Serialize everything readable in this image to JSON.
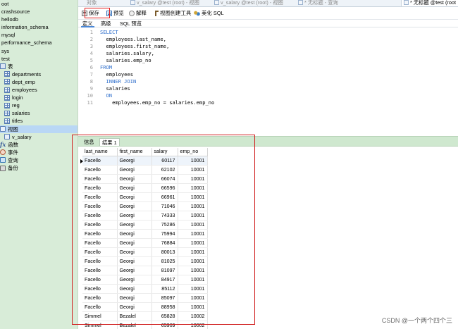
{
  "sidebar": {
    "items": [
      {
        "label": "oot",
        "icon": "database-icon",
        "kind": "db"
      },
      {
        "label": "crashsource",
        "icon": "database-icon",
        "kind": "db"
      },
      {
        "label": "hellodb",
        "icon": "database-icon",
        "kind": "db"
      },
      {
        "label": "information_schema",
        "icon": "database-icon",
        "kind": "db"
      },
      {
        "label": "mysql",
        "icon": "database-icon",
        "kind": "db"
      },
      {
        "label": "performance_schema",
        "icon": "database-icon",
        "kind": "db"
      },
      {
        "label": "sys",
        "icon": "database-icon",
        "kind": "db"
      },
      {
        "label": "test",
        "icon": "database-icon",
        "kind": "db"
      },
      {
        "label": "表",
        "icon": "tables-folder-icon",
        "kind": "folder"
      },
      {
        "label": "departments",
        "icon": "table-icon",
        "kind": "table"
      },
      {
        "label": "dept_emp",
        "icon": "table-icon",
        "kind": "table"
      },
      {
        "label": "employees",
        "icon": "table-icon",
        "kind": "table"
      },
      {
        "label": "login",
        "icon": "table-icon",
        "kind": "table"
      },
      {
        "label": "reg",
        "icon": "table-icon",
        "kind": "table"
      },
      {
        "label": "salaries",
        "icon": "table-icon",
        "kind": "table"
      },
      {
        "label": "titles",
        "icon": "table-icon",
        "kind": "table"
      },
      {
        "label": "视图",
        "icon": "views-folder-icon",
        "kind": "folder-selected"
      },
      {
        "label": "v_salary",
        "icon": "view-icon",
        "kind": "view"
      },
      {
        "label": "函数",
        "icon": "function-icon",
        "kind": "func"
      },
      {
        "label": "事件",
        "icon": "event-icon",
        "kind": "event"
      },
      {
        "label": "查询",
        "icon": "query-icon",
        "kind": "query"
      },
      {
        "label": "备份",
        "icon": "backup-icon",
        "kind": "backup"
      }
    ]
  },
  "tabs": [
    {
      "label": "对象"
    },
    {
      "label": "v_salary @test (root) - 视图"
    },
    {
      "label": "v_salary @test (root) - 视图"
    },
    {
      "label": "* 无标题 - 查询"
    },
    {
      "label": "* 无标题 @test (root"
    }
  ],
  "toolbar": {
    "save": "保存",
    "preview": "预览",
    "explain": "解释",
    "builder": "视图创建工具",
    "beautify": "美化 SQL"
  },
  "subtabs": [
    "定义",
    "高级",
    "SQL 预览"
  ],
  "editor": {
    "lines": [
      {
        "n": "1",
        "text": "SELECT",
        "kw": true
      },
      {
        "n": "2",
        "text": "  employees.last_name,"
      },
      {
        "n": "3",
        "text": "  employees.first_name,"
      },
      {
        "n": "4",
        "text": "  salaries.salary,"
      },
      {
        "n": "5",
        "text": "  salaries.emp_no"
      },
      {
        "n": "6",
        "text": "FROM",
        "kw": true
      },
      {
        "n": "7",
        "text": "  employees"
      },
      {
        "n": "8",
        "text": "  INNER JOIN",
        "kw": true
      },
      {
        "n": "9",
        "text": "  salaries"
      },
      {
        "n": "10",
        "text": "  ON",
        "kw": true
      },
      {
        "n": "11",
        "text": "    employees.emp_no = salaries.emp_no"
      }
    ]
  },
  "results": {
    "tabs": [
      "信息",
      "结果 1"
    ],
    "columns": [
      "last_name",
      "first_name",
      "salary",
      "emp_no"
    ],
    "rows": [
      [
        "Facello",
        "Georgi",
        "60117",
        "10001"
      ],
      [
        "Facello",
        "Georgi",
        "62102",
        "10001"
      ],
      [
        "Facello",
        "Georgi",
        "66074",
        "10001"
      ],
      [
        "Facello",
        "Georgi",
        "66596",
        "10001"
      ],
      [
        "Facello",
        "Georgi",
        "66961",
        "10001"
      ],
      [
        "Facello",
        "Georgi",
        "71046",
        "10001"
      ],
      [
        "Facello",
        "Georgi",
        "74333",
        "10001"
      ],
      [
        "Facello",
        "Georgi",
        "75286",
        "10001"
      ],
      [
        "Facello",
        "Georgi",
        "75994",
        "10001"
      ],
      [
        "Facello",
        "Georgi",
        "76884",
        "10001"
      ],
      [
        "Facello",
        "Georgi",
        "80013",
        "10001"
      ],
      [
        "Facello",
        "Georgi",
        "81025",
        "10001"
      ],
      [
        "Facello",
        "Georgi",
        "81097",
        "10001"
      ],
      [
        "Facello",
        "Georgi",
        "84917",
        "10001"
      ],
      [
        "Facello",
        "Georgi",
        "85112",
        "10001"
      ],
      [
        "Facello",
        "Georgi",
        "85097",
        "10001"
      ],
      [
        "Facello",
        "Georgi",
        "88958",
        "10001"
      ],
      [
        "Simmel",
        "Bezalel",
        "65828",
        "10002"
      ],
      [
        "Simmel",
        "Bezalel",
        "65909",
        "10002"
      ],
      [
        "Simmel",
        "Bezalel",
        "67534",
        "10002"
      ]
    ]
  },
  "watermark": "CSDN @一个两个四个三"
}
